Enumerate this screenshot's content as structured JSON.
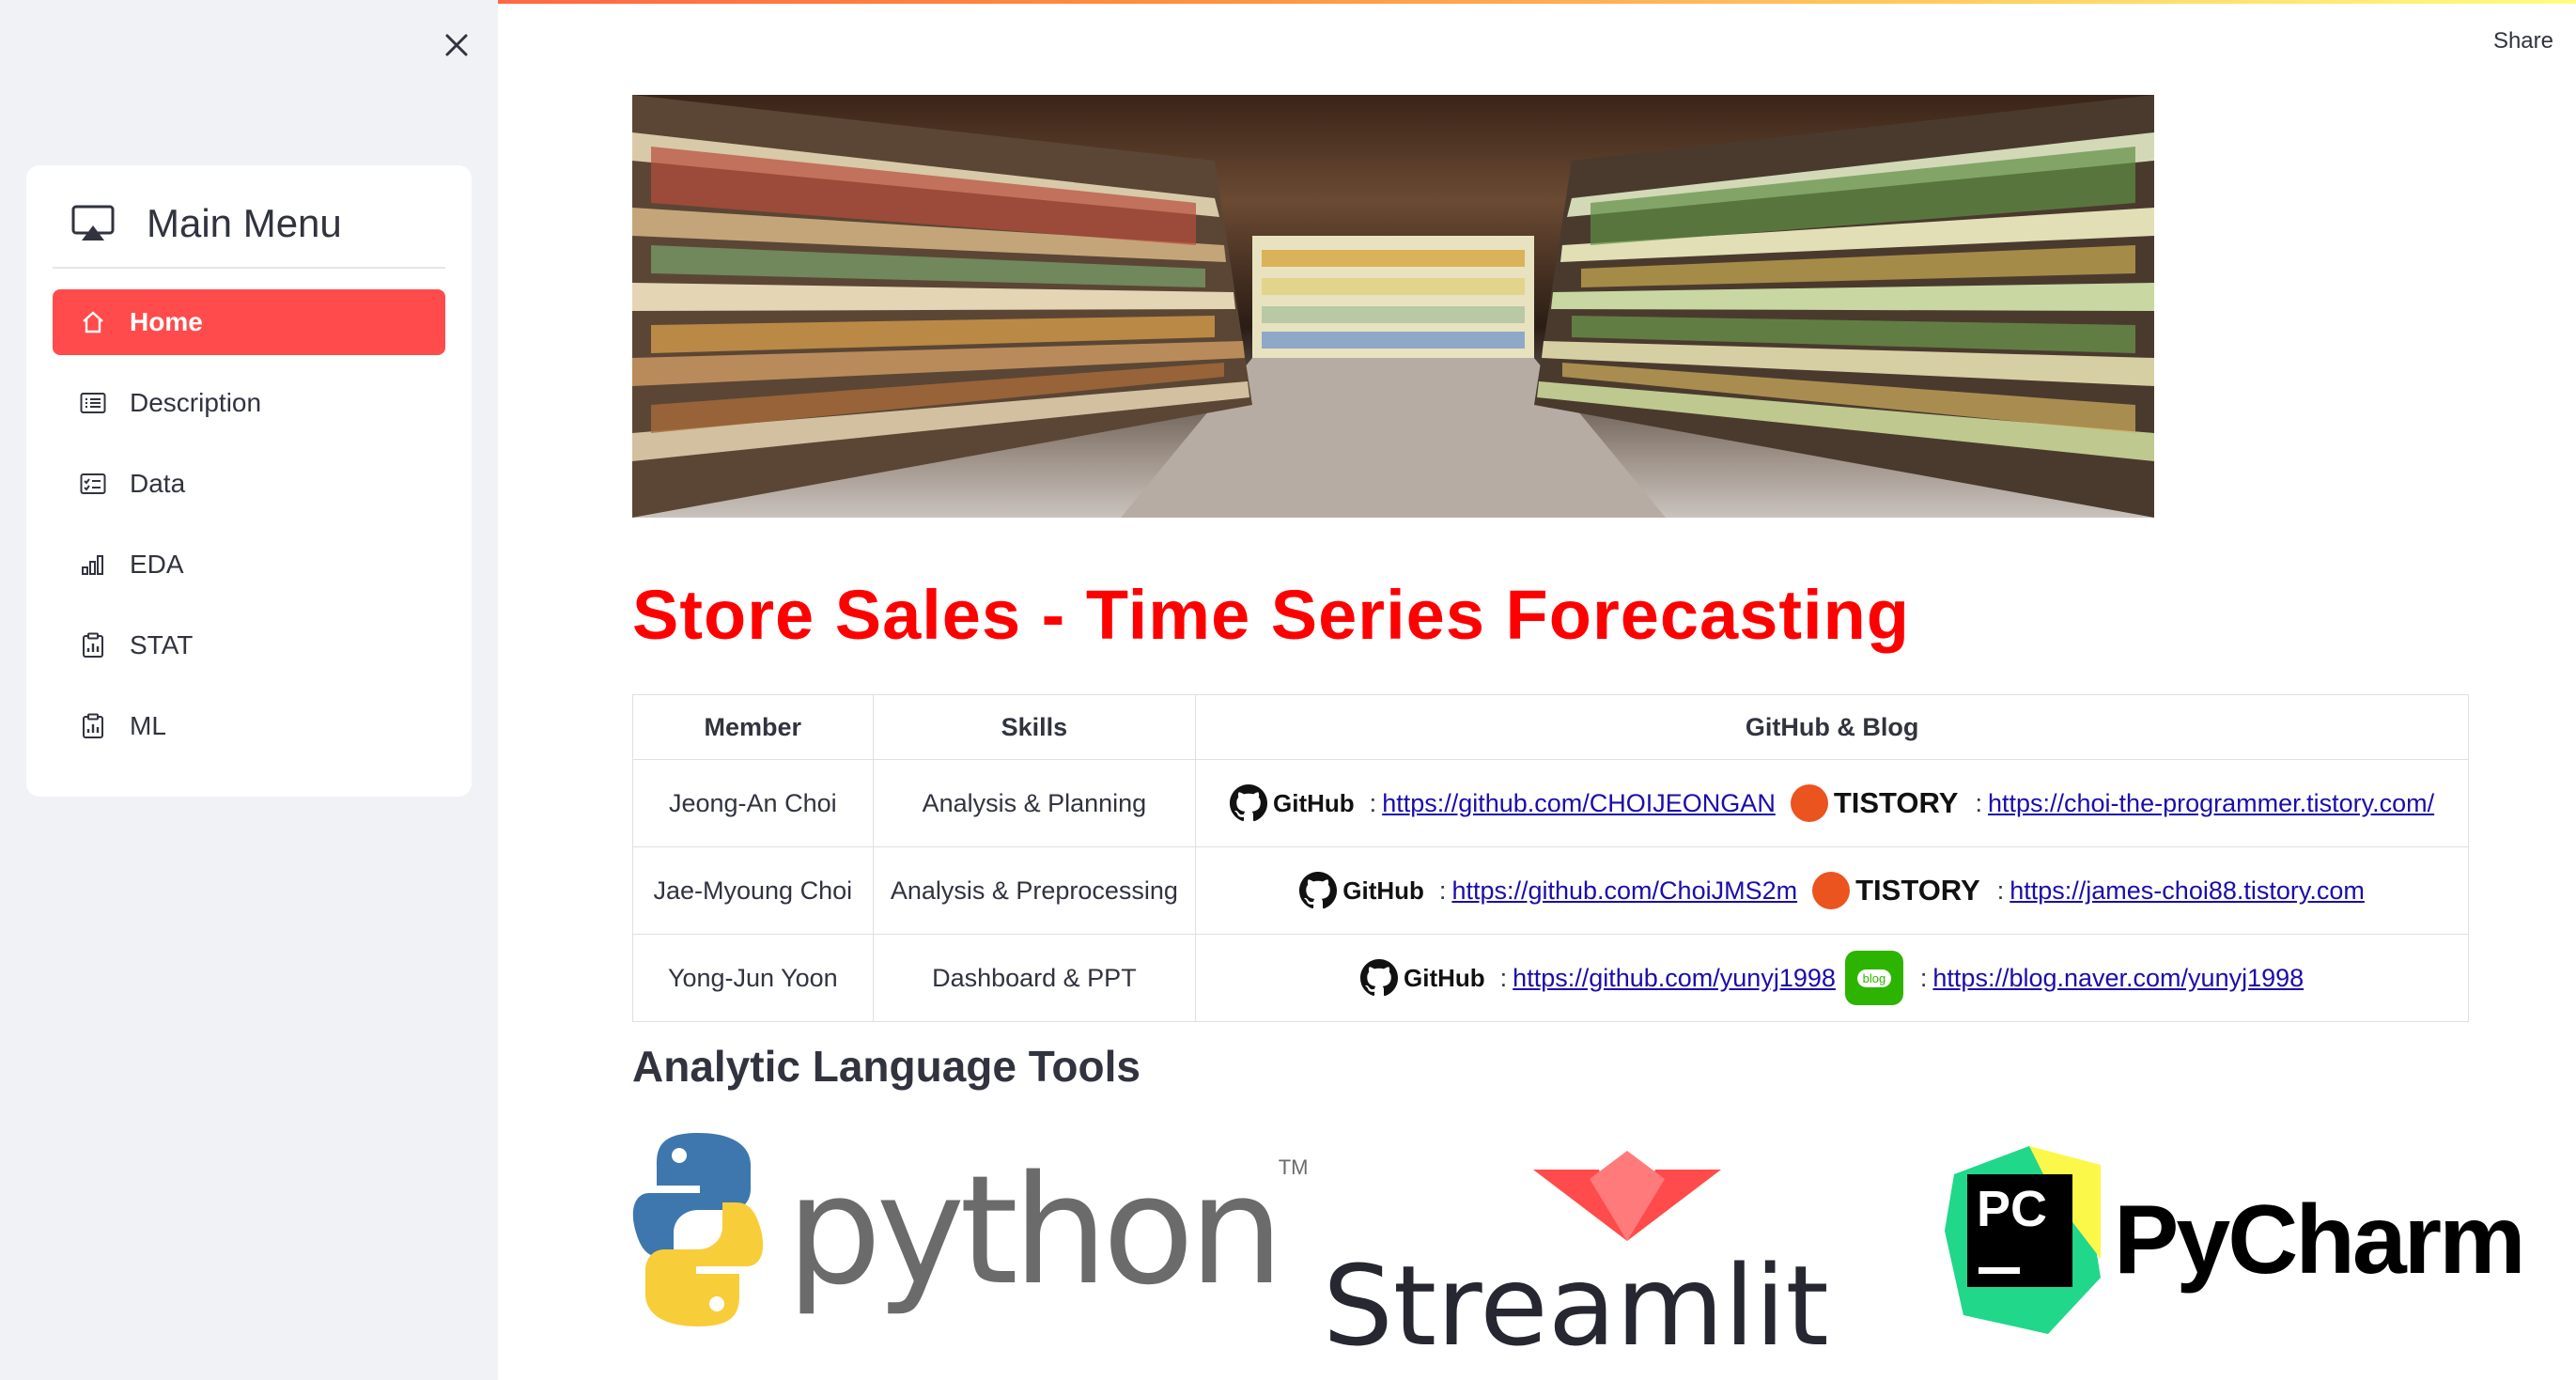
{
  "sidebar": {
    "menu_title": "Main Menu",
    "items": [
      {
        "label": "Home",
        "icon": "house-icon",
        "active": true
      },
      {
        "label": "Description",
        "icon": "card-list-icon"
      },
      {
        "label": "Data",
        "icon": "card-checklist-icon"
      },
      {
        "label": "EDA",
        "icon": "bar-chart-icon"
      },
      {
        "label": "STAT",
        "icon": "clipboard-data-icon"
      },
      {
        "label": "ML",
        "icon": "clipboard-data-icon"
      }
    ]
  },
  "header": {
    "share_label": "Share"
  },
  "page": {
    "title": "Store Sales - Time Series Forecasting"
  },
  "team_table": {
    "headers": [
      "Member",
      "Skills",
      "GitHub & Blog"
    ],
    "rows": [
      {
        "member": "Jeong-An Choi",
        "skills": "Analysis & Planning",
        "github": "https://github.com/CHOIJEONGAN",
        "blog_type": "TISTORY",
        "blog": "https://choi-the-programmer.tistory.com/"
      },
      {
        "member": "Jae-Myoung Choi",
        "skills": "Analysis & Preprocessing",
        "github": "https://github.com/ChoiJMS2m",
        "blog_type": "TISTORY",
        "blog": "https://james-choi88.tistory.com"
      },
      {
        "member": "Yong-Jun Yoon",
        "skills": "Dashboard & PPT",
        "github": "https://github.com/yunyj1998",
        "blog_type": "blog",
        "blog": "https://blog.naver.com/yunyj1998"
      }
    ],
    "github_label": "GitHub",
    "tistory_label": "TISTORY",
    "naver_label": "blog",
    "separator": ":"
  },
  "tools": {
    "section_title": "Analytic Language Tools",
    "python": "python",
    "python_tm": "TM",
    "streamlit": "Streamlit",
    "pycharm_badge": "PC",
    "pycharm": "PyCharm"
  },
  "colors": {
    "accent": "#ff4b4b",
    "title_red": "#ff0000",
    "sidebar_bg": "#f0f2f6",
    "link": "#1a0dab",
    "tistory_orange": "#eb531f",
    "naver_green": "#2db400"
  }
}
